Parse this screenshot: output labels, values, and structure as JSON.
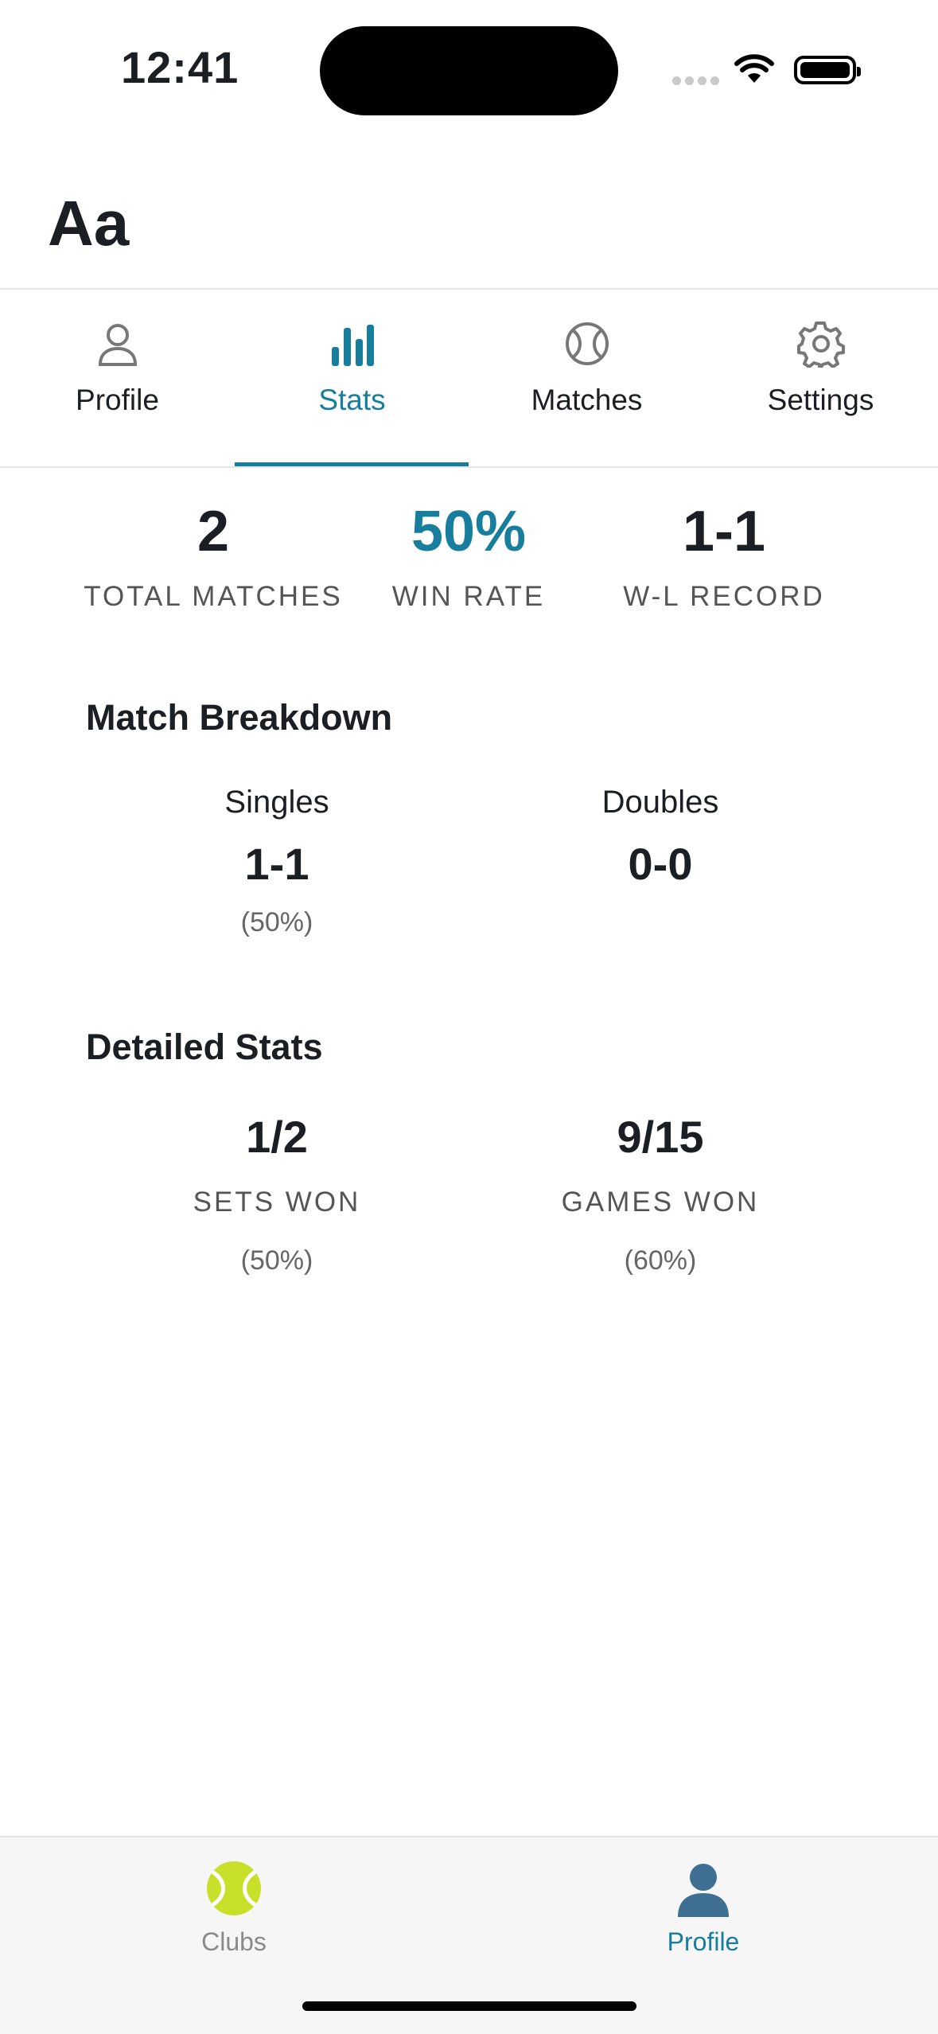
{
  "status_bar": {
    "time": "12:41"
  },
  "header": {
    "title": "Aa"
  },
  "tabs": [
    {
      "label": "Profile",
      "icon": "person-icon"
    },
    {
      "label": "Stats",
      "icon": "bar-chart-icon",
      "active": true
    },
    {
      "label": "Matches",
      "icon": "tennis-ball-icon"
    },
    {
      "label": "Settings",
      "icon": "gear-icon"
    }
  ],
  "summary": [
    {
      "value": "2",
      "caption": "TOTAL MATCHES"
    },
    {
      "value": "50%",
      "caption": "WIN RATE"
    },
    {
      "value": "1-1",
      "caption": "W-L RECORD"
    }
  ],
  "match_breakdown": {
    "title": "Match Breakdown",
    "singles": {
      "label": "Singles",
      "record": "1-1",
      "percent": "(50%)"
    },
    "doubles": {
      "label": "Doubles",
      "record": "0-0"
    }
  },
  "detailed_stats": {
    "title": "Detailed Stats",
    "sets": {
      "value": "1/2",
      "caption": "SETS WON",
      "percent": "(50%)"
    },
    "games": {
      "value": "9/15",
      "caption": "GAMES WON",
      "percent": "(60%)"
    }
  },
  "bottom_tabs": [
    {
      "label": "Clubs",
      "icon": "tennis-ball-icon"
    },
    {
      "label": "Profile",
      "icon": "person-silhouette-icon",
      "active": true
    }
  ],
  "colors": {
    "accent": "#177e9e",
    "text": "#1b1f23",
    "muted": "#555555"
  }
}
